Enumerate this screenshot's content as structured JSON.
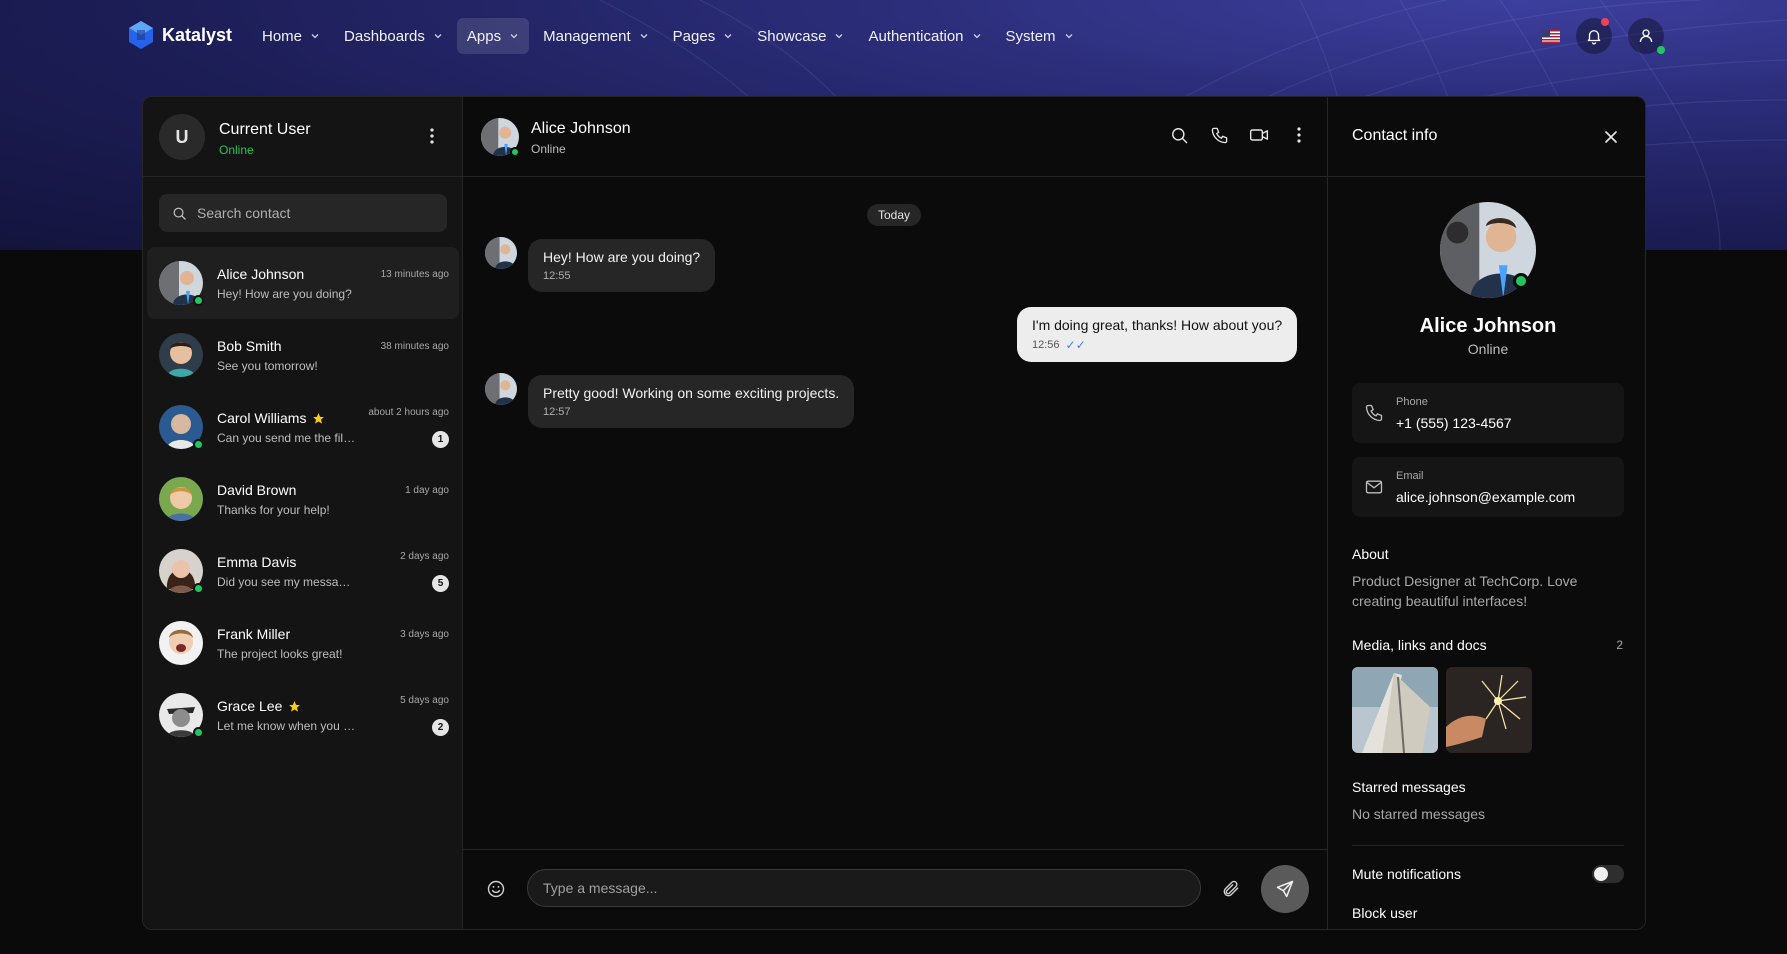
{
  "brand": {
    "name": "Katalyst"
  },
  "nav": {
    "items": [
      {
        "label": "Home"
      },
      {
        "label": "Dashboards"
      },
      {
        "label": "Apps"
      },
      {
        "label": "Management"
      },
      {
        "label": "Pages"
      },
      {
        "label": "Showcase"
      },
      {
        "label": "Authentication"
      },
      {
        "label": "System"
      }
    ],
    "active": "Apps"
  },
  "current_user": {
    "initial": "U",
    "name": "Current User",
    "status": "Online"
  },
  "search": {
    "placeholder": "Search contact"
  },
  "contacts": [
    {
      "name": "Alice Johnson",
      "message": "Hey! How are you doing?",
      "time": "13 minutes ago",
      "online": true,
      "starred": false,
      "unread": ""
    },
    {
      "name": "Bob Smith",
      "message": "See you tomorrow!",
      "time": "38 minutes ago",
      "online": false,
      "starred": false,
      "unread": ""
    },
    {
      "name": "Carol Williams",
      "message": "Can you send me the files?",
      "time": "about 2 hours ago",
      "online": true,
      "starred": true,
      "unread": "1"
    },
    {
      "name": "David Brown",
      "message": "Thanks for your help!",
      "time": "1 day ago",
      "online": false,
      "starred": false,
      "unread": ""
    },
    {
      "name": "Emma Davis",
      "message": "Did you see my message?",
      "time": "2 days ago",
      "online": true,
      "starred": false,
      "unread": "5"
    },
    {
      "name": "Frank Miller",
      "message": "The project looks great!",
      "time": "3 days ago",
      "online": false,
      "starred": false,
      "unread": ""
    },
    {
      "name": "Grace Lee",
      "message": "Let me know when you are free",
      "time": "5 days ago",
      "online": true,
      "starred": true,
      "unread": "2"
    }
  ],
  "chat": {
    "name": "Alice Johnson",
    "status": "Online",
    "date_divider": "Today",
    "messages": [
      {
        "text": "Hey! How are you doing?",
        "time": "12:55",
        "mine": false
      },
      {
        "text": "I'm doing great, thanks! How about you?",
        "time": "12:56",
        "mine": true,
        "read": "✓✓"
      },
      {
        "text": "Pretty good! Working on some exciting projects.",
        "time": "12:57",
        "mine": false
      }
    ],
    "composer_placeholder": "Type a message..."
  },
  "contact_info": {
    "title": "Contact info",
    "name": "Alice Johnson",
    "status": "Online",
    "phone_label": "Phone",
    "phone": "+1 (555) 123-4567",
    "email_label": "Email",
    "email": "alice.johnson@example.com",
    "about_title": "About",
    "about": "Product Designer at TechCorp. Love creating beautiful interfaces!",
    "media_title": "Media, links and docs",
    "media_count": "2",
    "starred_title": "Starred messages",
    "starred_empty": "No starred messages",
    "mute_label": "Mute notifications",
    "mute_on": false,
    "block_label": "Block user"
  },
  "colors": {
    "online": "#22c55e",
    "accent_blue": "#3b82f6",
    "star": "#facc15",
    "notify": "#ef4354"
  }
}
